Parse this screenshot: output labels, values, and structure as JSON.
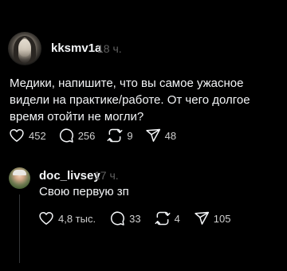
{
  "post": {
    "username": "kksmv1a",
    "time": "18 ч.",
    "text": "Медики, напишите, что вы самое ужасное видели на практике/работе. От чего долгое время отойти не могли?",
    "likes": "452",
    "comments": "256",
    "reposts": "9",
    "shares": "48"
  },
  "reply": {
    "username": "doc_livsey",
    "time": "17 ч.",
    "text": "Свою первую зп",
    "likes": "4,8 тыс.",
    "comments": "33",
    "reposts": "4",
    "shares": "105"
  },
  "icons": {
    "like": "heart-icon",
    "comment": "comment-bubble-icon",
    "repost": "repost-arrows-icon",
    "share": "send-paper-plane-icon"
  },
  "colors": {
    "background": "#000000",
    "primary_text": "#f3f5f7",
    "secondary_text": "#616161",
    "thread_line": "#333638"
  }
}
